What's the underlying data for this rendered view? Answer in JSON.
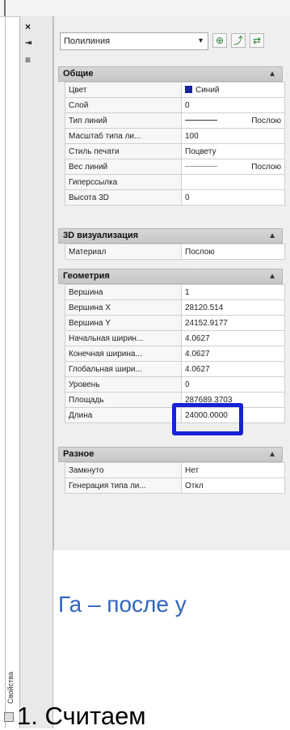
{
  "sidebar": {
    "close": "×",
    "pin": "⇥",
    "menu": "≡",
    "label": "Свойства"
  },
  "dropdown": {
    "value": "Полилиния",
    "arrow": "▾"
  },
  "toolbar": {
    "button1": "⊕",
    "button2": "⤴",
    "button3": "⇄"
  },
  "sections": [
    {
      "title": "Общие",
      "toggle": "▲",
      "rows": [
        {
          "label": "Цвет",
          "value": "Синий",
          "type": "color"
        },
        {
          "label": "Слой",
          "value": "0"
        },
        {
          "label": "Тип линий",
          "value": "Послою",
          "type": "line"
        },
        {
          "label": "Масштаб типа ли...",
          "value": "100"
        },
        {
          "label": "Стиль печати",
          "value": "Поцвету"
        },
        {
          "label": "Вес линий",
          "value": "Послою",
          "type": "thin"
        },
        {
          "label": "Гиперссылка",
          "value": ""
        },
        {
          "label": "Высота 3D",
          "value": "0"
        }
      ]
    },
    {
      "title": "3D визуализация",
      "toggle": "▲",
      "rows": [
        {
          "label": "Материал",
          "value": "Послою"
        }
      ]
    },
    {
      "title": "Геометрия",
      "toggle": "▲",
      "rows": [
        {
          "label": "Вершина",
          "value": "1"
        },
        {
          "label": "Вершина X",
          "value": "28120.514"
        },
        {
          "label": "Вершина Y",
          "value": "24152.9177"
        },
        {
          "label": "Начальная ширин...",
          "value": "4.0627"
        },
        {
          "label": "Конечная ширина...",
          "value": "4.0627"
        },
        {
          "label": "Глобальная шири...",
          "value": "4.0627"
        },
        {
          "label": "Уровень",
          "value": "0"
        },
        {
          "label": "Площадь",
          "value": "287689.3703"
        },
        {
          "label": "Длина",
          "value": "24000.0000"
        }
      ]
    },
    {
      "title": "Разное",
      "toggle": "▲",
      "rows": [
        {
          "label": "Замкнуто",
          "value": "Нет"
        },
        {
          "label": "Генерация типа ли...",
          "value": "Откл"
        }
      ]
    }
  ],
  "caption": "Га – после у",
  "bottom_text": "1. Считаем"
}
